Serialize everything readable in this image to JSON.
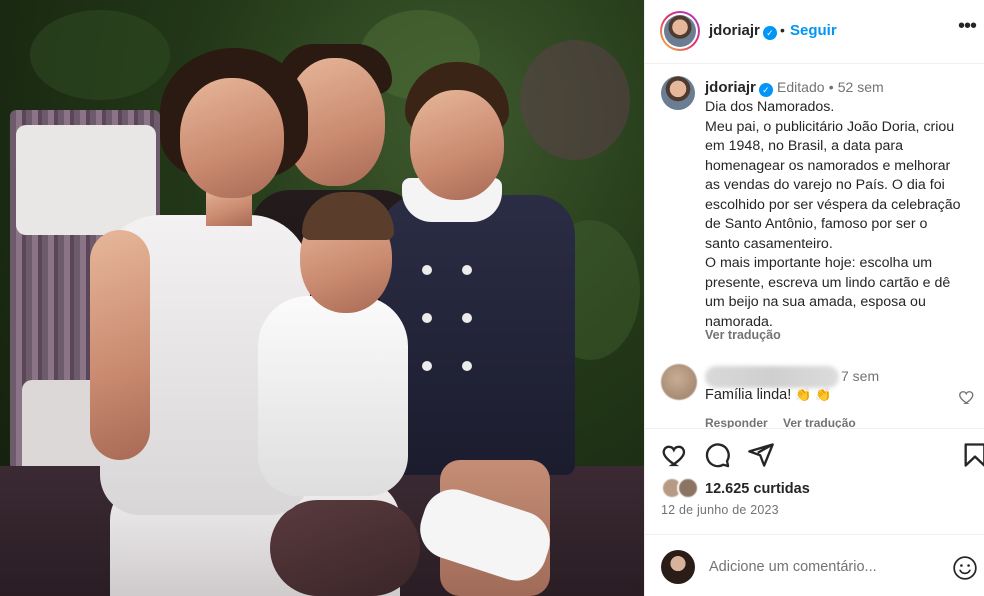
{
  "post": {
    "photo_alt": "Fotografia de família colorizada",
    "header": {
      "username": "jdoriajr",
      "verified_badge": "✓",
      "separator": "•",
      "follow_label": "Seguir",
      "more_icon": "more-horizontal-icon",
      "more_label": "•••"
    },
    "caption": {
      "username": "jdoriajr",
      "edited": "Editado",
      "separator": "•",
      "age": "52 sem",
      "lines": [
        "Dia dos Namorados.",
        "Meu pai, o publicitário João Doria, criou",
        "em 1948, no Brasil, a data para",
        "homenagear os namorados e melhorar",
        "as vendas do varejo no País. O dia foi",
        "escolhido por ser véspera da celebração",
        "de Santo Antônio, famoso por ser o",
        "santo casamenteiro.",
        "O mais importante hoje: escolha um",
        "presente, escreva um lindo cartão e dê",
        "um beijo na sua amada, esposa ou",
        "namorada."
      ],
      "see_translation": "Ver tradução"
    },
    "comment": {
      "age": "7 sem",
      "text": "Família linda!",
      "emoji": "👏 👏",
      "reply_label": "Responder",
      "see_translation": "Ver tradução"
    },
    "actions": {
      "like_icon": "heart-icon",
      "comment_icon": "comment-icon",
      "share_icon": "share-icon",
      "save_icon": "bookmark-icon"
    },
    "likes_text": "12.625 curtidas",
    "date": "12 de junho de 2023",
    "composer": {
      "placeholder": "Adicione um comentário...",
      "emoji_icon": "emoji-icon"
    }
  },
  "colors": {
    "accent": "#0095f6",
    "text": "#262626",
    "muted": "#737373",
    "divider": "#efefef"
  }
}
